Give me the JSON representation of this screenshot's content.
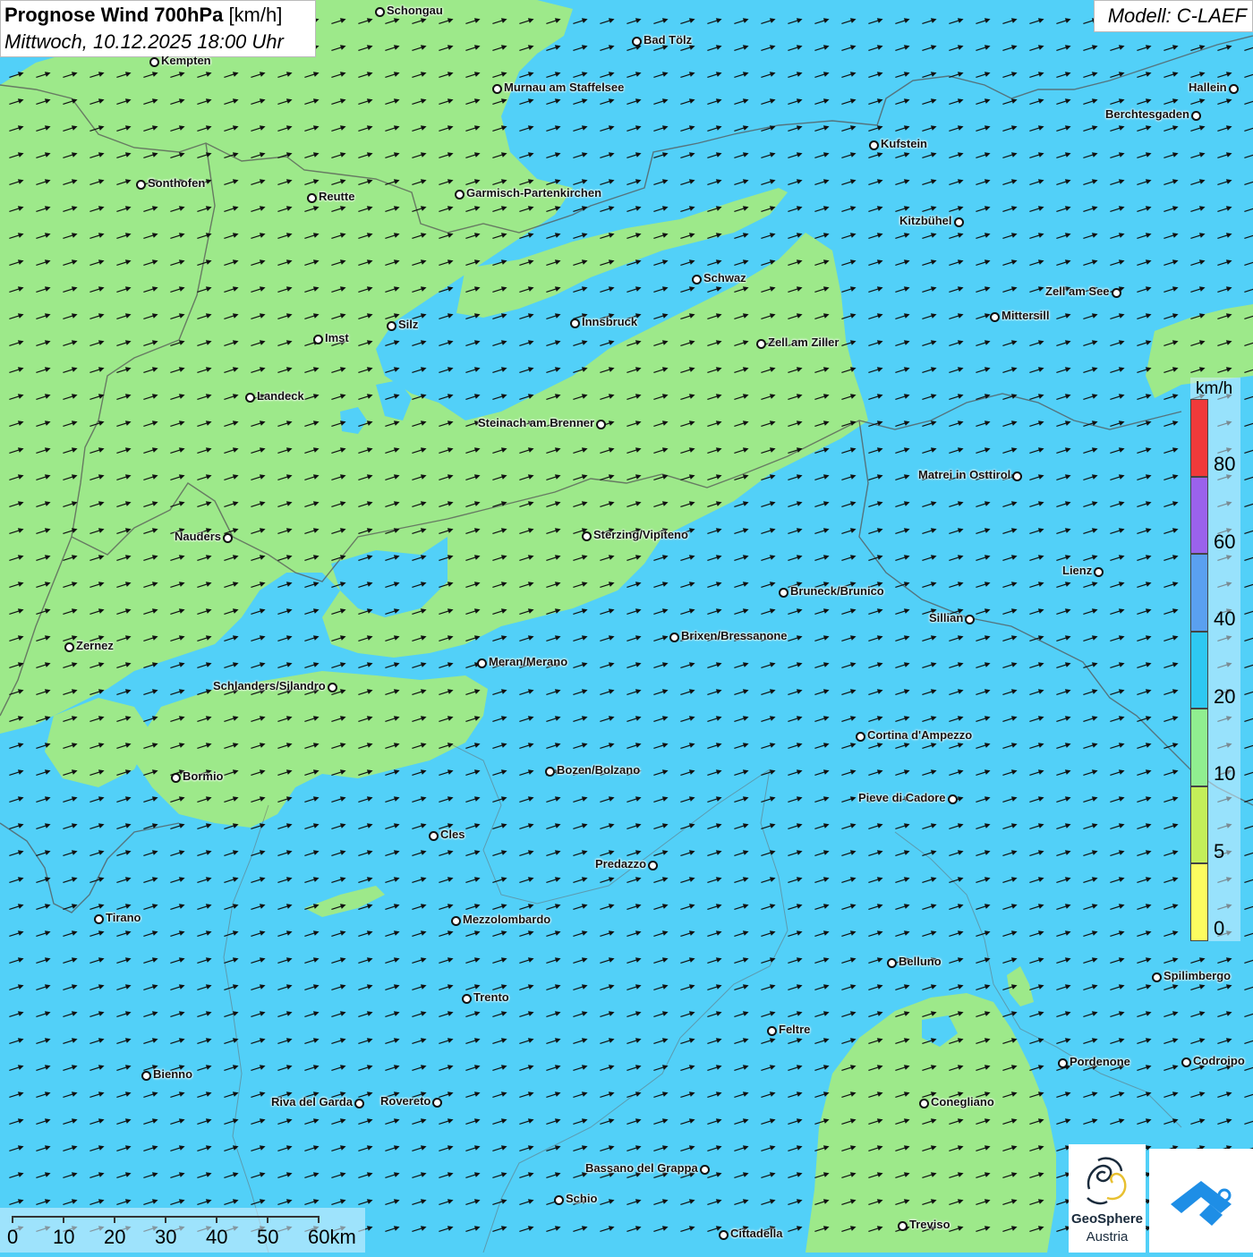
{
  "header": {
    "title_bold": "Prognose Wind 700hPa",
    "title_unit": "[km/h]",
    "datetime": "Mittwoch, 10.12.2025 18:00 Uhr",
    "model": "Modell: C-LAEF"
  },
  "legend": {
    "unit": "km/h",
    "ticks": [
      "80",
      "60",
      "40",
      "20",
      "10",
      "5",
      "0"
    ],
    "colors": [
      "#f03a3a",
      "#9a62ec",
      "#5aa0f0",
      "#2ec8f2",
      "#90ee90",
      "#c4ef59",
      "#fcfc60"
    ]
  },
  "scale": {
    "labels": [
      "0",
      "10",
      "20",
      "30",
      "40",
      "50",
      "60km"
    ]
  },
  "logos": {
    "geosphere_line1": "GeoSphere",
    "geosphere_line2": "Austria",
    "geosphere_icon": "geosphere-swirl-icon",
    "app_icon": "weather-app-icon"
  },
  "colors": {
    "wind_10_20": "#52d0f8",
    "wind_5_10": "#9de98a",
    "arrow": "#111111",
    "border": "#555555"
  },
  "cities": [
    {
      "name": "Schongau"
    },
    {
      "name": "Bad Tölz"
    },
    {
      "name": "Kempten"
    },
    {
      "name": "Murnau am Staffelsee"
    },
    {
      "name": "Hallein"
    },
    {
      "name": "Berchtesgaden"
    },
    {
      "name": "Kufstein"
    },
    {
      "name": "Sonthofen"
    },
    {
      "name": "Reutte"
    },
    {
      "name": "Garmisch-Partenkirchen"
    },
    {
      "name": "Kitzbühel"
    },
    {
      "name": "Schwaz"
    },
    {
      "name": "Zell am See"
    },
    {
      "name": "Mittersill"
    },
    {
      "name": "Imst"
    },
    {
      "name": "Silz"
    },
    {
      "name": "Innsbruck"
    },
    {
      "name": "Zell am Ziller"
    },
    {
      "name": "Landeck"
    },
    {
      "name": "Steinach am Brenner"
    },
    {
      "name": "Matrei in Osttirol"
    },
    {
      "name": "Nauders"
    },
    {
      "name": "Sterzing/Vipiteno"
    },
    {
      "name": "Lienz"
    },
    {
      "name": "Bruneck/Brunico"
    },
    {
      "name": "Sillian"
    },
    {
      "name": "Zernez"
    },
    {
      "name": "Brixen/Bressanone"
    },
    {
      "name": "Meran/Merano"
    },
    {
      "name": "Schlanders/Silandro"
    },
    {
      "name": "Cortina d'Ampezzo"
    },
    {
      "name": "Bozen/Bolzano"
    },
    {
      "name": "Bormio"
    },
    {
      "name": "Pieve di Cadore"
    },
    {
      "name": "Cles"
    },
    {
      "name": "Predazzo"
    },
    {
      "name": "Tirano"
    },
    {
      "name": "Mezzolombardo"
    },
    {
      "name": "Belluno"
    },
    {
      "name": "Spilimbergo"
    },
    {
      "name": "Trento"
    },
    {
      "name": "Feltre"
    },
    {
      "name": "Bienno"
    },
    {
      "name": "Pordenone"
    },
    {
      "name": "Codroipo"
    },
    {
      "name": "Riva del Garda"
    },
    {
      "name": "Rovereto"
    },
    {
      "name": "Conegliano"
    },
    {
      "name": "Bassano del Grappa"
    },
    {
      "name": "Schio"
    },
    {
      "name": "Treviso"
    },
    {
      "name": "Cittadella"
    }
  ]
}
